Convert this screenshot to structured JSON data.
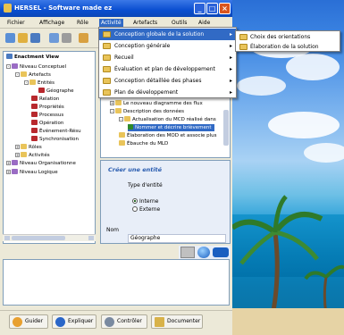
{
  "window": {
    "title": "HERSEL - Software made ez"
  },
  "menu": {
    "items": [
      "Fichier",
      "Affichage",
      "Rôle",
      "Activité",
      "Artefacts",
      "Outils",
      "Aide"
    ]
  },
  "tree": {
    "header": "Enactment View",
    "nodes": [
      {
        "label": "Niveau Conceptuel",
        "level": 0
      },
      {
        "label": "Artefacts",
        "level": 1
      },
      {
        "label": "Entités",
        "level": 2
      },
      {
        "label": "Géographe",
        "level": 3
      },
      {
        "label": "Relation",
        "level": 3
      },
      {
        "label": "Propriétés",
        "level": 3
      },
      {
        "label": "Processus",
        "level": 3
      },
      {
        "label": "Opération",
        "level": 3
      },
      {
        "label": "Événement-Résu",
        "level": 3
      },
      {
        "label": "Synchronisation",
        "level": 3
      },
      {
        "label": "Rôles",
        "level": 1
      },
      {
        "label": "Activités",
        "level": 1
      },
      {
        "label": "Niveau Organisationne",
        "level": 0
      },
      {
        "label": "Niveau Logique",
        "level": 0
      }
    ]
  },
  "activity_tree": {
    "items": [
      {
        "label": "Le nouveau diagramme des flux"
      },
      {
        "label": "Description des données"
      },
      {
        "label": "Actualisation du MCD réalisé dans"
      },
      {
        "label": "Nommer et décrire brièvement"
      },
      {
        "label": "Élaboration des MOD et associe plus"
      },
      {
        "label": "Ébauche du MLD"
      }
    ]
  },
  "properties": {
    "title": "Créer une entité",
    "type_label": "Type d'entité",
    "options": [
      "Interne",
      "Externe"
    ],
    "selected": "Interne",
    "name_label": "Nom",
    "name_value": "Géographe"
  },
  "navigation": {
    "buttons": [
      "Guider",
      "Expliquer",
      "Contrôler",
      "Documenter"
    ]
  },
  "activity_menu": {
    "items": [
      {
        "label": "Conception globale de la solution",
        "has_submenu": true,
        "highlighted": true
      },
      {
        "label": "Conception générale",
        "has_submenu": true
      },
      {
        "label": "Recueil",
        "has_submenu": true
      },
      {
        "label": "Évaluation et plan de développement",
        "has_submenu": true
      },
      {
        "label": "Conception détaillée des phases",
        "has_submenu": true
      },
      {
        "label": "Plan de développement",
        "has_submenu": true
      }
    ]
  },
  "submenu": {
    "items": [
      "Choix des orientations",
      "Élaboration de la solution"
    ]
  }
}
